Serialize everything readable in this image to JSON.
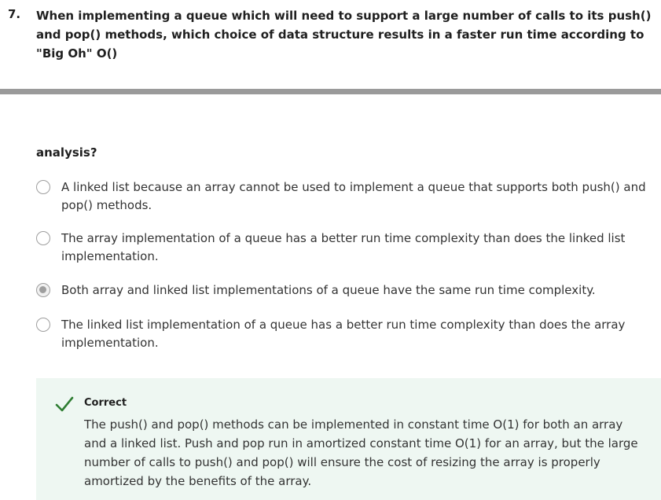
{
  "question": {
    "number": "7.",
    "text": "When implementing a queue which will need to support a large number of calls to its push() and pop() methods, which choice of data structure results in a faster run time according to \"Big Oh\" O()",
    "text_continued": "analysis?"
  },
  "options": [
    {
      "label": "A linked list because an array cannot be used to implement a queue that supports both push() and pop() methods.",
      "selected": false
    },
    {
      "label": "The array implementation of a queue has a better run time complexity than does the linked list implementation.",
      "selected": false
    },
    {
      "label": "Both array and linked list implementations of a queue have the same run time complexity.",
      "selected": true
    },
    {
      "label": "The linked list implementation of a queue has a better run time complexity than does the array implementation.",
      "selected": false
    }
  ],
  "feedback": {
    "icon": "check-icon",
    "status": "Correct",
    "status_color": "#2e7d32",
    "text": "The push() and pop() methods can be implemented in constant time O(1) for both an array and a linked list. Push and pop run in amortized constant time O(1) for an array, but the large number of calls to push() and pop() will ensure the cost of resizing the array is properly amortized by the benefits of the array."
  }
}
